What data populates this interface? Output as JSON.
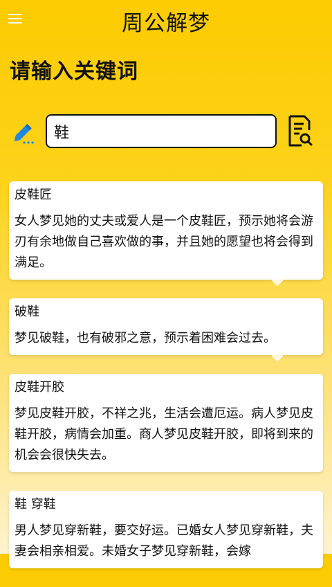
{
  "appbar": {
    "title": "周公解梦",
    "menu_icon": "menu-icon"
  },
  "prompt": "请输入关键词",
  "search": {
    "value": "鞋",
    "placeholder": "",
    "input_icon": "pencil-icon",
    "search_icon": "document-search-icon"
  },
  "results": [
    {
      "title": "皮鞋匠",
      "body": "女人梦见她的丈夫或爱人是一个皮鞋匠，预示她将会游刃有余地做自己喜欢做的事，并且她的愿望也将会得到满足。"
    },
    {
      "title": "破鞋",
      "body": "梦见破鞋，也有破邪之意，预示着困难会过去。"
    },
    {
      "title": "皮鞋开胶",
      "body": "梦见皮鞋开胶，不祥之兆，生活会遭厄运。病人梦见皮鞋开胶，病情会加重。商人梦见皮鞋开胶，即将到来的机会会很快失去。"
    },
    {
      "title": "鞋 穿鞋",
      "body": "男人梦见穿新鞋，要交好运。已婚女人梦见穿新鞋，夫妻会相亲相爱。未婚女子梦见穿新鞋，会嫁"
    }
  ],
  "colors": {
    "accent_yellow": "#fccb00",
    "icon_blue": "#1e88e5"
  }
}
